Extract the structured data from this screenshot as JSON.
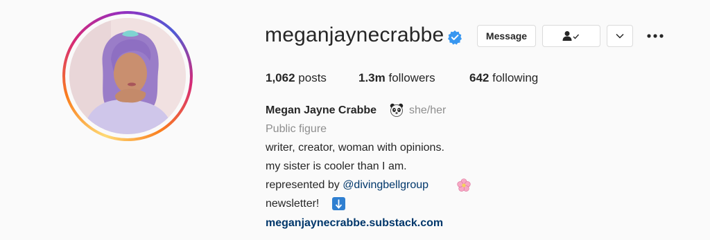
{
  "profile": {
    "username": "meganjaynecrabbe",
    "full_name": "Megan Jayne Crabbe",
    "pronouns": "she/her",
    "category": "Public figure",
    "verified_icon": "verified-badge-icon",
    "accent_color": "#3897f0",
    "link_color": "#00376b"
  },
  "actions": {
    "message_label": "Message",
    "following_icon": "person-check-icon",
    "suggest_icon": "chevron-down-icon",
    "more_icon": "more-options-icon"
  },
  "stats": {
    "posts_value": "1,062",
    "posts_label": "posts",
    "followers_value": "1.3m",
    "followers_label": "followers",
    "following_value": "642",
    "following_label": "following"
  },
  "bio": {
    "line1": "writer, creator, woman with opinions.",
    "line2": "my sister is cooler than I am.",
    "line3_prefix": "represented by ",
    "line3_mention": "@divingbellgroup",
    "line4": "newsletter!",
    "emoji_icons": [
      "panda-emoji-icon",
      "cherry-blossom-emoji-icon",
      "down-arrow-emoji-icon"
    ],
    "website": "meganjaynecrabbe.substack.com"
  }
}
